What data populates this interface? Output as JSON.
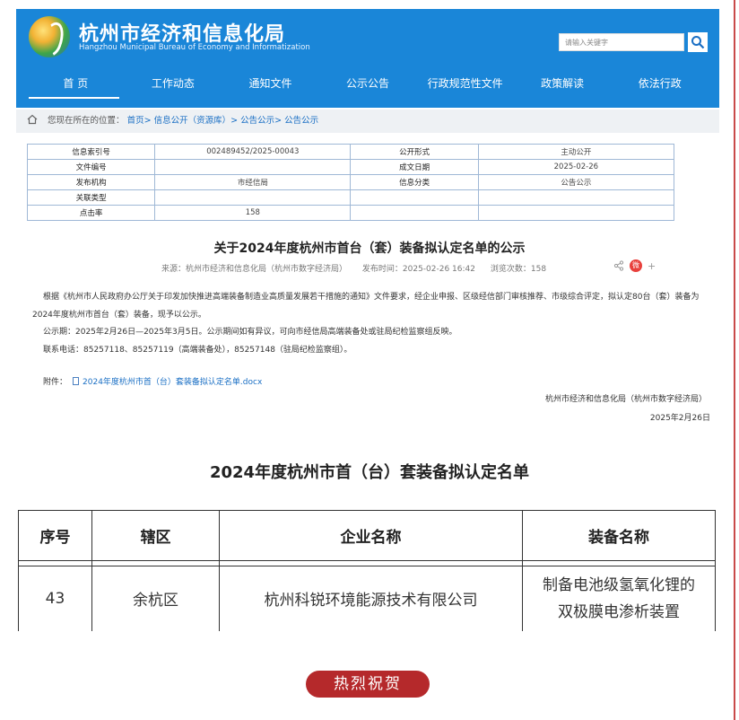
{
  "header": {
    "title": "杭州市经济和信息化局",
    "subtitle": "Hangzhou Municipal Bureau of Economy and Informatization",
    "search_placeholder": "请输入关键字",
    "brand_color": "#1a86d8"
  },
  "nav": [
    "首 页",
    "工作动态",
    "通知文件",
    "公示公告",
    "行政规范性文件",
    "政策解读",
    "依法行政"
  ],
  "breadcrumb": {
    "prefix": "您现在所在的位置：",
    "items": [
      "首页>",
      "信息公开（资源库）>",
      "公告公示>",
      "公告公示"
    ]
  },
  "info": {
    "rows": [
      [
        "信息索引号",
        "002489452/2025-00043",
        "公开形式",
        "主动公开"
      ],
      [
        "文件编号",
        "",
        "成文日期",
        "2025-02-26"
      ],
      [
        "发布机构",
        "市经信局",
        "信息分类",
        "公告公示"
      ],
      [
        "关联类型",
        "",
        "",
        ""
      ],
      [
        "点击率",
        "158",
        "",
        ""
      ]
    ]
  },
  "article": {
    "title": "关于2024年度杭州市首台（套）装备拟认定名单的公示",
    "source": "来源：杭州市经济和信息化局（杭州市数字经济局）",
    "time": "发布时间：2025-02-26 16:42",
    "views": "浏览次数：158",
    "plus": "+",
    "weibo": "微",
    "p1": "根据《杭州市人民政府办公厅关于印发加快推进高端装备制造业高质量发展若干措施的通知》文件要求，经企业申报、区级经信部门审核推荐、市级综合评定，拟认定80台（套）装备为2024年度杭州市首台（套）装备，现予以公示。",
    "p2": "公示期：2025年2月26日—2025年3月5日。公示期间如有异议，可向市经信局高端装备处或驻局纪检监察组反映。",
    "p3": "联系电话：85257118、85257119（高端装备处），85257148（驻局纪检监察组）。",
    "attach_label": "附件：",
    "attach_file": "2024年度杭州市首（台）套装备拟认定名单.docx",
    "sign_org": "杭州市经济和信息化局（杭州市数字经济局）",
    "sign_date": "2025年2月26日"
  },
  "list": {
    "title": "2024年度杭州市首（台）套装备拟认定名单",
    "headers": [
      "序号",
      "辖区",
      "企业名称",
      "装备名称"
    ],
    "row": {
      "no": "43",
      "district": "余杭区",
      "company": "杭州科锐环境能源技术有限公司",
      "equipment_line1": "制备电池级氢氧化锂的",
      "equipment_line2": "双极膜电渗析装置"
    }
  },
  "congrats": "热烈祝贺"
}
